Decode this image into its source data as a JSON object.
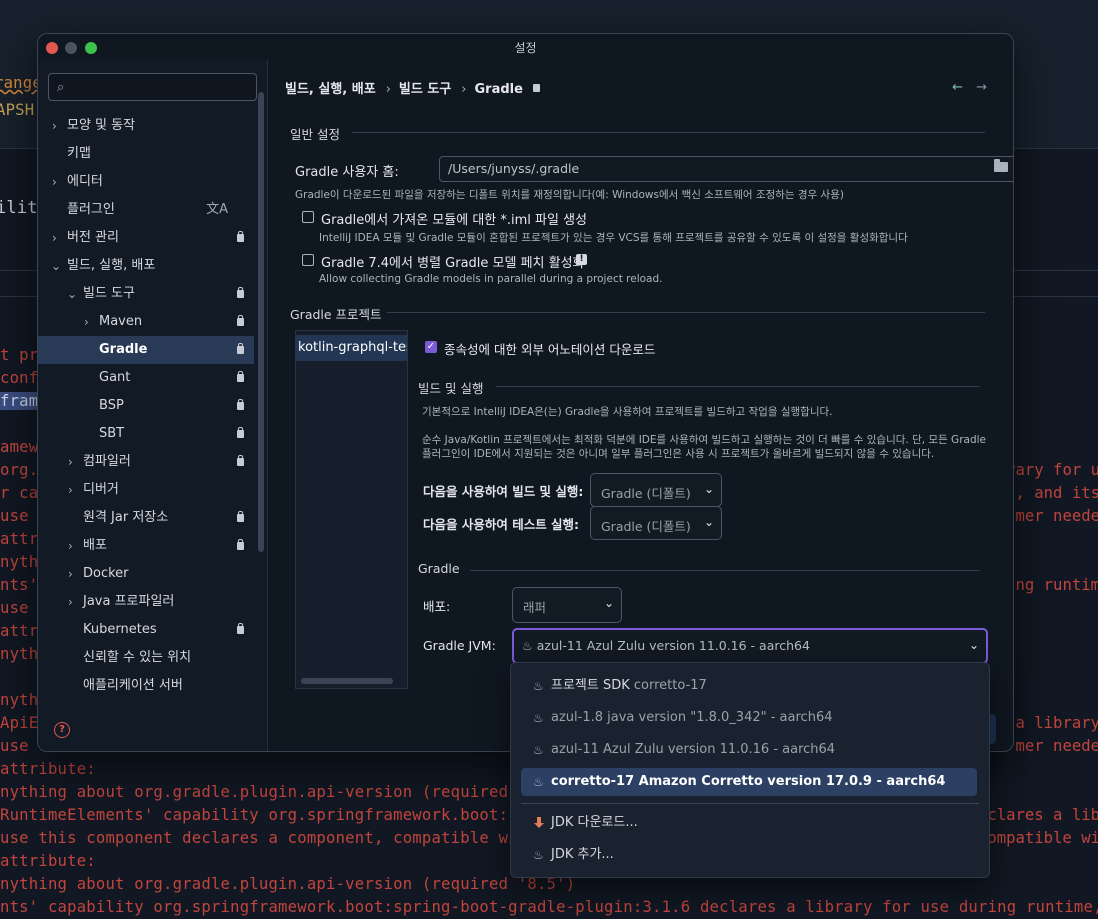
{
  "window": {
    "title": "설정"
  },
  "search": {
    "placeholder": ""
  },
  "sidebar": {
    "items": [
      {
        "label": "모양 및 동작",
        "chevron": "›"
      },
      {
        "label": "키맵"
      },
      {
        "label": "에디터",
        "chevron": "›"
      },
      {
        "label": "플러그인"
      },
      {
        "label": "버전 관리",
        "chevron": "›"
      },
      {
        "label": "빌드, 실행, 배포",
        "chevron": "⌄"
      },
      {
        "label": "빌드 도구",
        "chevron": "⌄"
      },
      {
        "label": "Maven",
        "chevron": "›"
      },
      {
        "label": "Gradle"
      },
      {
        "label": "Gant"
      },
      {
        "label": "BSP"
      },
      {
        "label": "SBT"
      },
      {
        "label": "컴파일러",
        "chevron": "›"
      },
      {
        "label": "디버거",
        "chevron": "›"
      },
      {
        "label": "원격 Jar 저장소"
      },
      {
        "label": "배포",
        "chevron": "›"
      },
      {
        "label": "Docker",
        "chevron": "›"
      },
      {
        "label": "Java 프로파일러",
        "chevron": "›"
      },
      {
        "label": "Kubernetes"
      },
      {
        "label": "신뢰할 수 있는 위치"
      },
      {
        "label": "애플리케이션 서버"
      }
    ],
    "help": "?"
  },
  "breadcrumb": {
    "part1": "빌드, 실행, 배포",
    "part2": "빌드 도구",
    "part3": "Gradle",
    "sep": "›"
  },
  "nav": {
    "back": "←",
    "forward": "→"
  },
  "general": {
    "title": "일반 설정",
    "user_home_label": "Gradle 사용자 홈:",
    "user_home_value": "/Users/junyss/.gradle",
    "user_home_hint": "Gradle이 다운로드된 파일을 저장하는 디폴트 위치를 재정의합니다(예: Windows에서 백신 소프트웨어 조정하는 경우 사용)",
    "iml_label": "Gradle에서 가져온 모듈에 대한 *.iml 파일 생성",
    "iml_hint": "IntelliJ IDEA 모듈 및 Gradle 모듈이 혼합된 프로젝트가 있는 경우 VCS를 통해 프로젝트를 공유할 수 있도록 이 설정을 활성화합니다",
    "parallel_label": "Gradle 7.4에서 병렬 Gradle 모델 페치 활성화",
    "parallel_hint": "Allow collecting Gradle models in parallel during a project reload."
  },
  "projects": {
    "title": "Gradle 프로젝트",
    "items": [
      "kotlin-graphql-test"
    ],
    "download_annotations_label": "종속성에 대한 외부 어노테이션 다운로드",
    "build_run_title": "빌드 및 실행",
    "build_run_hint1": "기본적으로 IntelliJ IDEA은(는) Gradle을 사용하여 프로젝트를 빌드하고 작업을 실행합니다.",
    "build_run_hint2": "순수 Java/Kotlin 프로젝트에서는 최적화 덕분에 IDE를 사용하여 빌드하고 실행하는 것이 더 빠를 수 있습니다. 단, 모든 Gradle",
    "build_run_hint3": "플러그인이 IDE에서 지원되는 것은 아니며 일부 플러그인은 사용 시 프로젝트가 올바르게 빌드되지 않을 수 있습니다.",
    "build_with_label": "다음을 사용하여 빌드 및 실행:",
    "build_with_value": "Gradle (디폴트)",
    "test_with_label": "다음을 사용하여 테스트 실행:",
    "test_with_value": "Gradle (디폴트)",
    "gradle_title": "Gradle",
    "dist_label": "배포:",
    "dist_value": "래퍼",
    "jvm_label": "Gradle JVM:",
    "jvm_value": "azul-11 Azul Zulu version 11.0.16 - aarch64"
  },
  "jvm_dropdown": {
    "items": [
      {
        "name": "프로젝트 SDK",
        "detail": "corretto-17"
      },
      {
        "name": "azul-1.8 java version \"1.8.0_342\" - aarch64"
      },
      {
        "name": "azul-11 Azul Zulu version 11.0.16 - aarch64"
      },
      {
        "name": "corretto-17 Amazon Corretto version 17.0.9 - aarch64"
      }
    ],
    "download_jdk": "JDK 다운로드...",
    "add_jdk": "JDK 추가..."
  },
  "terminal": {
    "top_lines": [
      "range",
      "APSH",
      "ility"
    ],
    "lines": [
      "t pro",
      "config",
      "frame",
      "amewo",
      "org.spr",
      "r capa",
      "use t",
      "attri",
      "nythi",
      "nts'",
      "use t",
      "attri",
      "nythi",
      "nythi",
      "ApiE",
      "use t",
      "attribute:",
      "nything about org.gradle.plugin.api-version (required '8.5')",
      "RuntimeElements' capability org.springframework.boot:",
      "use this component declares a component, compatible wi",
      "attribute:",
      "nything about org.gradle.plugin.api-version (required '8.5')",
      "nts' capability org.springframework.boot:spring-boot-gradle-plugin:3.1.6 declares a library for use during runtime,"
    ],
    "right_lines": [
      "rary for u",
      ", and its",
      "mer neede",
      "ng runtim",
      "a library",
      "mer neede",
      "clares a lib",
      "ompatible wi"
    ]
  }
}
